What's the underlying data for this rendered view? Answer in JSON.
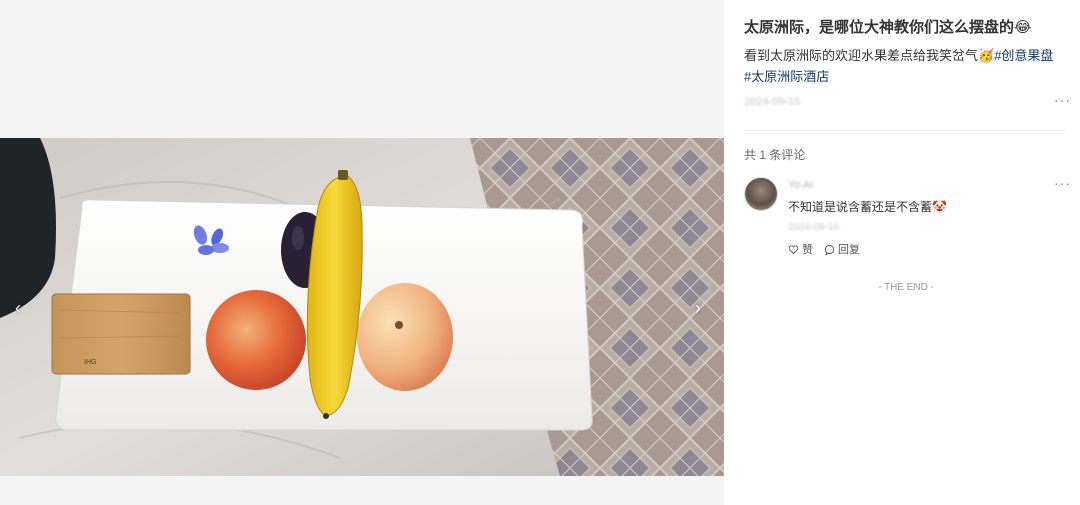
{
  "post": {
    "title": "太原洲际，是哪位大神教你们这么摆盘的😂",
    "description": "看到太原洲际的欢迎水果差点给我笑岔气🥳",
    "tags": [
      "#创意果盘",
      "#太原洲际酒店"
    ],
    "date": "2024-09-15",
    "more_icon": "ellipsis-icon"
  },
  "comments": {
    "count_label": "共 1 条评论",
    "items": [
      {
        "author": "Yo Ai",
        "text": "不知道是说含蓄还是不含蓄🤡",
        "date": "2024-09-16",
        "like_label": "赞",
        "reply_label": "回复"
      }
    ]
  },
  "footer": {
    "end_label": "- THE END -"
  },
  "media": {
    "prev_icon": "chevron-left-icon",
    "next_icon": "chevron-right-icon",
    "card_text": "IHG"
  }
}
